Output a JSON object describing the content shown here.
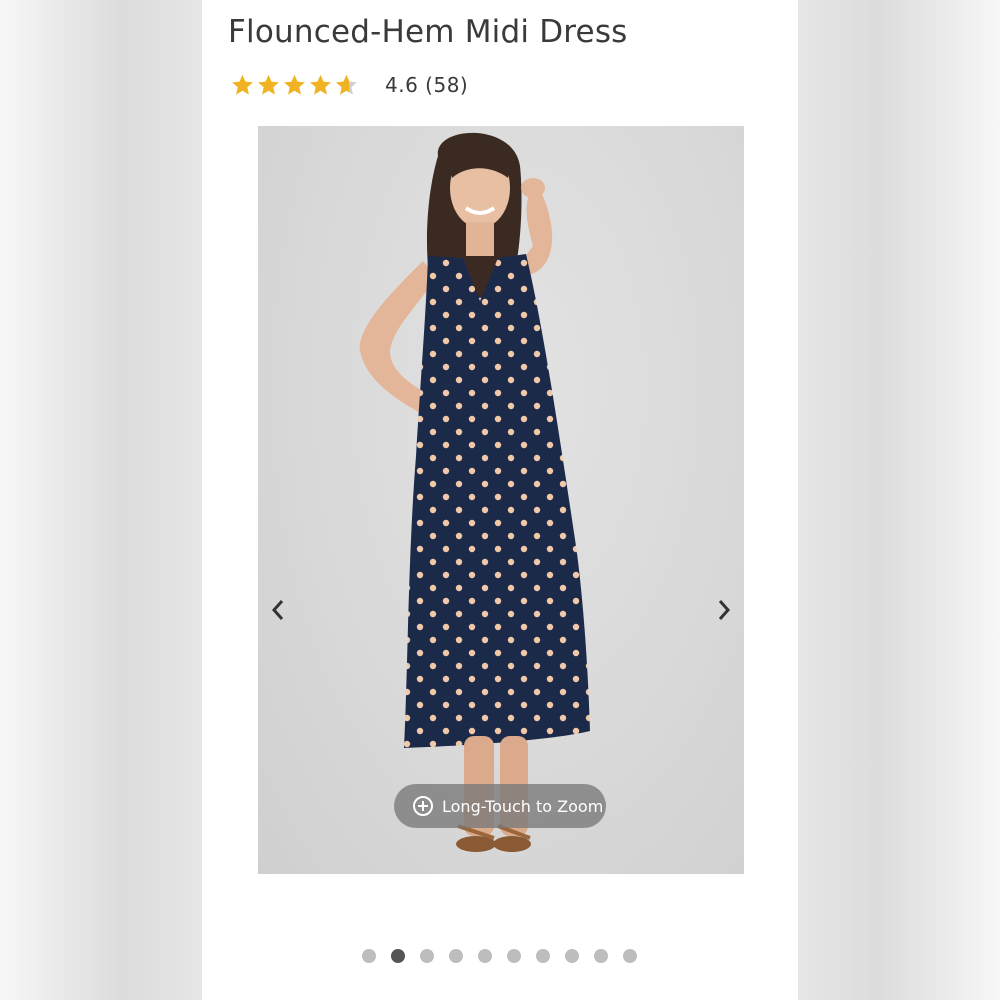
{
  "product": {
    "title": "Flounced-Hem Midi Dress",
    "rating": {
      "value": 4.6,
      "text": "4.6 (58)",
      "count": 58,
      "max_stars": 5
    }
  },
  "gallery": {
    "zoom_hint": "Long-Touch to Zoom",
    "prev_icon": "chevron-left-icon",
    "next_icon": "chevron-right-icon",
    "total_images": 10,
    "active_index": 1
  },
  "colors": {
    "star": "#f0b323",
    "star_empty": "#cfcfcf",
    "dress": "#1c2a4a",
    "dots": "#f1c9a8",
    "active_dot": "#555555",
    "inactive_dot": "#bdbdbd"
  }
}
